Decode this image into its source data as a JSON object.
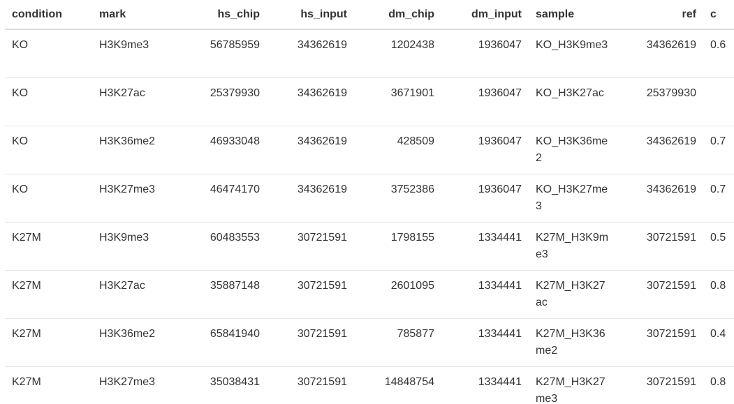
{
  "table": {
    "columns": [
      {
        "key": "condition",
        "label": "condition",
        "align": "left"
      },
      {
        "key": "mark",
        "label": "mark",
        "align": "left"
      },
      {
        "key": "hs_chip",
        "label": "hs_chip",
        "align": "right"
      },
      {
        "key": "hs_input",
        "label": "hs_input",
        "align": "right"
      },
      {
        "key": "dm_chip",
        "label": "dm_chip",
        "align": "right"
      },
      {
        "key": "dm_input",
        "label": "dm_input",
        "align": "right"
      },
      {
        "key": "sample",
        "label": "sample",
        "align": "left"
      },
      {
        "key": "ref",
        "label": "ref",
        "align": "right"
      },
      {
        "key": "extra",
        "label": "c",
        "align": "left"
      }
    ],
    "rows": [
      {
        "condition": "KO",
        "mark": "H3K9me3",
        "hs_chip": "56785959",
        "hs_input": "34362619",
        "dm_chip": "1202438",
        "dm_input": "1936047",
        "sample": "KO_H3K9me3",
        "ref": "34362619",
        "extra": "0.6"
      },
      {
        "condition": "KO",
        "mark": "H3K27ac",
        "hs_chip": "25379930",
        "hs_input": "34362619",
        "dm_chip": "3671901",
        "dm_input": "1936047",
        "sample": "KO_H3K27ac",
        "ref": "25379930",
        "extra": ""
      },
      {
        "condition": "KO",
        "mark": "H3K36me2",
        "hs_chip": "46933048",
        "hs_input": "34362619",
        "dm_chip": "428509",
        "dm_input": "1936047",
        "sample": "KO_H3K36me2",
        "ref": "34362619",
        "extra": "0.7"
      },
      {
        "condition": "KO",
        "mark": "H3K27me3",
        "hs_chip": "46474170",
        "hs_input": "34362619",
        "dm_chip": "3752386",
        "dm_input": "1936047",
        "sample": "KO_H3K27me3",
        "ref": "34362619",
        "extra": "0.7"
      },
      {
        "condition": "K27M",
        "mark": "H3K9me3",
        "hs_chip": "60483553",
        "hs_input": "30721591",
        "dm_chip": "1798155",
        "dm_input": "1334441",
        "sample": "K27M_H3K9me3",
        "ref": "30721591",
        "extra": "0.5"
      },
      {
        "condition": "K27M",
        "mark": "H3K27ac",
        "hs_chip": "35887148",
        "hs_input": "30721591",
        "dm_chip": "2601095",
        "dm_input": "1334441",
        "sample": "K27M_H3K27ac",
        "ref": "30721591",
        "extra": "0.8"
      },
      {
        "condition": "K27M",
        "mark": "H3K36me2",
        "hs_chip": "65841940",
        "hs_input": "30721591",
        "dm_chip": "785877",
        "dm_input": "1334441",
        "sample": "K27M_H3K36me2",
        "ref": "30721591",
        "extra": "0.4"
      },
      {
        "condition": "K27M",
        "mark": "H3K27me3",
        "hs_chip": "35038431",
        "hs_input": "30721591",
        "dm_chip": "14848754",
        "dm_input": "1334441",
        "sample": "K27M_H3K27me3",
        "ref": "30721591",
        "extra": "0.8"
      }
    ]
  }
}
